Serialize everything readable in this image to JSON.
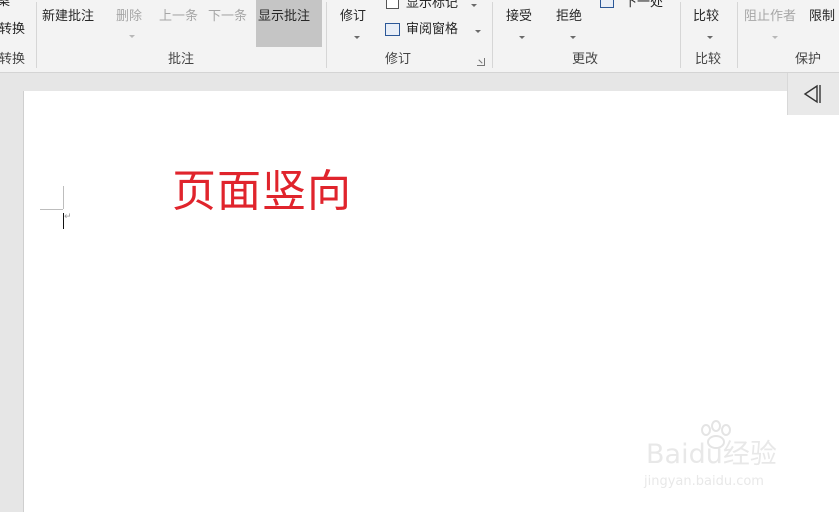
{
  "ribbon": {
    "left_partial_top": "案",
    "left_convert": "转换",
    "left_group_label": "转换",
    "comments": {
      "new_comment": "新建批注",
      "delete": "删除",
      "previous": "上一条",
      "next": "下一条",
      "show_comments": "显示批注",
      "group_label": "批注"
    },
    "tracking": {
      "track_changes": "修订",
      "show_markup": "显示标记",
      "reviewing_pane": "审阅窗格",
      "group_label": "修订"
    },
    "changes": {
      "accept": "接受",
      "reject": "拒绝",
      "next_change": "下一处",
      "group_label": "更改"
    },
    "compare": {
      "compare": "比较",
      "group_label": "比较"
    },
    "protect": {
      "block_authors": "阻止作者",
      "restrict_editing": "限制",
      "group_label": "保护"
    }
  },
  "document": {
    "heading": "页面竖向"
  },
  "watermark": {
    "main": "Baidu经验",
    "sub": "jingyan.baidu.com"
  },
  "colors": {
    "heading": "#e0242c",
    "ribbon_bg": "#f3f3f3",
    "highlight": "#c5c5c5"
  },
  "icons": [
    "collapse-pane-icon",
    "show-markup-icon",
    "reviewing-pane-icon",
    "next-change-icon",
    "compare-icon",
    "block-authors-icon"
  ]
}
